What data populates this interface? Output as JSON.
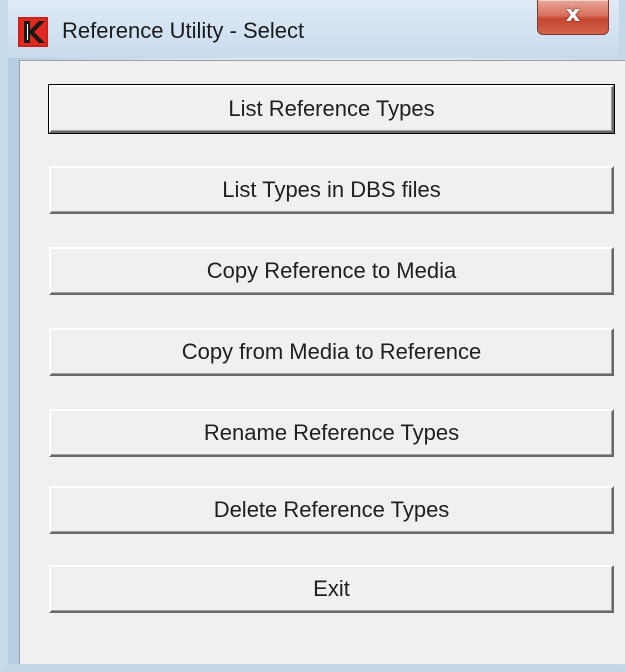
{
  "window": {
    "title": "Reference Utility - Select",
    "close_label": "x"
  },
  "buttons": [
    {
      "label": "List Reference Types"
    },
    {
      "label": "List Types in DBS files"
    },
    {
      "label": "Copy Reference to Media"
    },
    {
      "label": "Copy from Media to Reference"
    },
    {
      "label": "Rename Reference Types"
    },
    {
      "label": "Delete Reference Types"
    },
    {
      "label": "Exit"
    }
  ],
  "colors": {
    "icon_red": "#d0201a",
    "close_red": "#c4472f",
    "dialog_bg": "#f0f0f0"
  },
  "icons": {
    "app": "app-k-logo-icon",
    "close": "close-icon"
  }
}
